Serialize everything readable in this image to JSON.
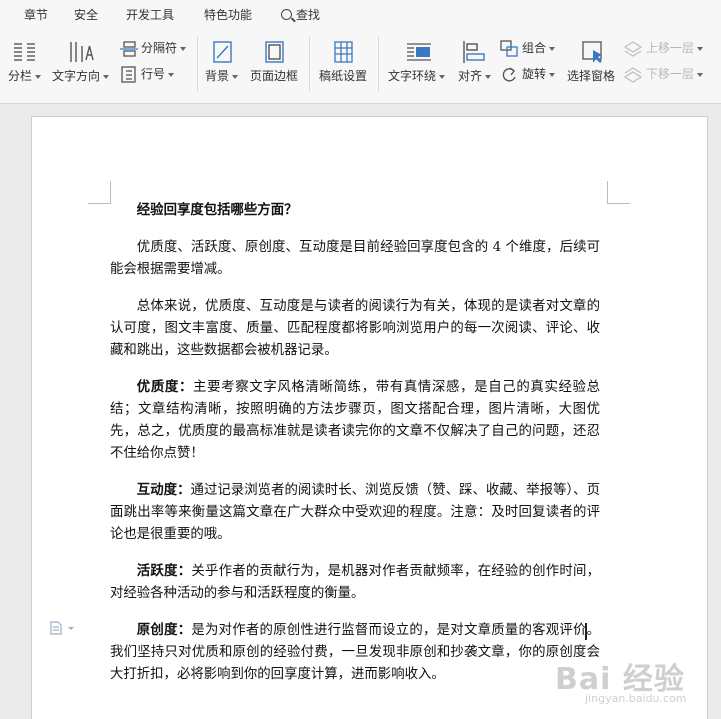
{
  "tabs": [
    "章节",
    "安全",
    "开发工具",
    "特色功能"
  ],
  "search_label": "查找",
  "toolbar": {
    "columns": "分栏",
    "text_direction": "文字方向",
    "separator": "分隔符",
    "line_number": "行号",
    "background": "背景",
    "page_border": "页面边框",
    "grid_paper": "稿纸设置",
    "text_wrap": "文字环绕",
    "align": "对齐",
    "group": "组合",
    "rotate": "旋转",
    "selection_pane": "选择窗格",
    "bring_forward": "上移一层",
    "send_backward": "下移一层"
  },
  "document": {
    "title": "经验回享度包括哪些方面？",
    "p1": "优质度、活跃度、原创度、互动度是目前经验回享度包含的 4 个维度，后续可能会根据需要增减。",
    "p2": "总体来说，优质度、互动度是与读者的阅读行为有关，体现的是读者对文章的认可度，图文丰富度、质量、匹配程度都将影响浏览用户的每一次阅读、评论、收藏和跳出，这些数据都会被机器记录。",
    "p3_term": "优质度：",
    "p3": "主要考察文字风格清晰简练，带有真情深感，是自己的真实经验总结；文章结构清晰，按照明确的方法步骤页，图文搭配合理，图片清晰，大图优先，总之，优质度的最高标准就是读者读完你的文章不仅解决了自己的问题，还忍不住给你点赞！",
    "p4_term": "互动度：",
    "p4": "通过记录浏览者的阅读时长、浏览反馈（赞、踩、收藏、举报等）、页面跳出率等来衡量这篇文章在广大群众中受欢迎的程度。注意：及时回复读者的评论也是很重要的哦。",
    "p5_term": "活跃度：",
    "p5": "关乎作者的贡献行为，是机器对作者贡献频率，在经验的创作时间，对经验各种活动的参与和活跃程度的衡量。",
    "p6_term": "原创度：",
    "p6": "是为对作者的原创性进行监督而设立的，是对文章质量的客观评价。我们坚持只对优质和原创的经验付费，一旦发现非原创和抄袭文章，你的原创度会大打折扣，必将影响到你的回享度计算，进而影响收入。"
  },
  "watermark": {
    "logo": "Bai 经验",
    "sub": "jingyan.baidu.com"
  },
  "colors": {
    "icon_blue": "#3b78c2",
    "icon_gray": "#555555",
    "page_bg": "#ffffff",
    "workspace": "#eaeaea"
  }
}
